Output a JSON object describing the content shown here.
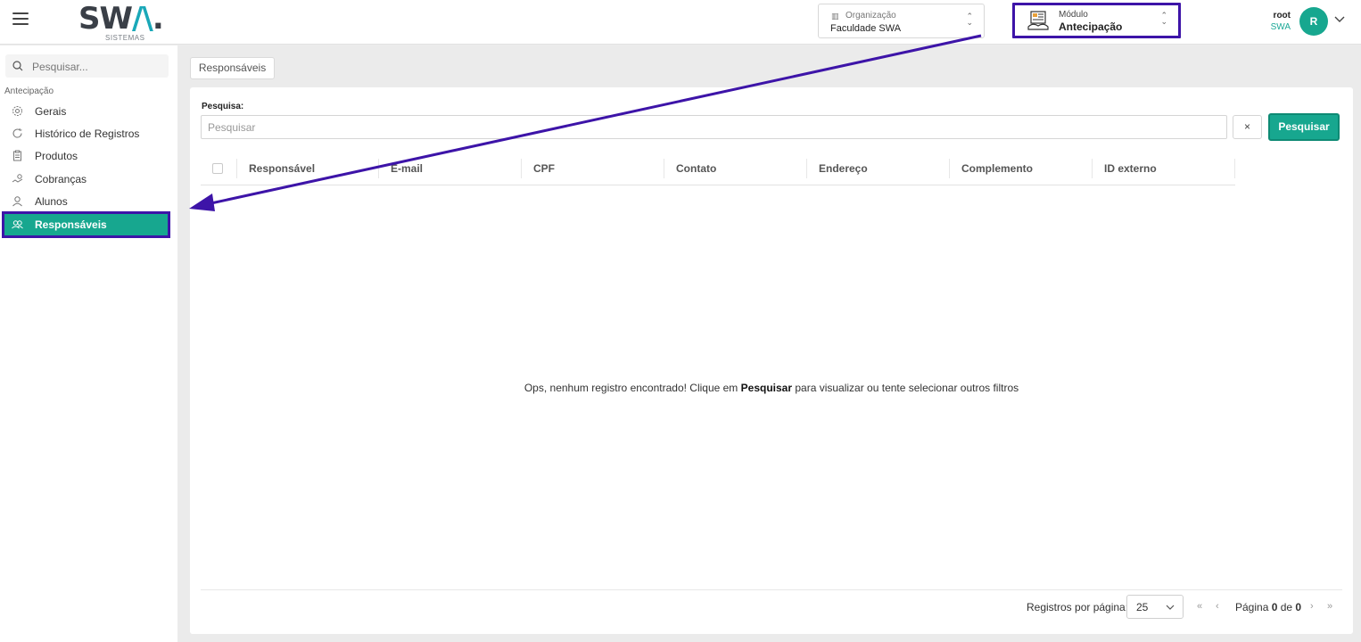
{
  "header": {
    "logo_main": "SW",
    "logo_accent": "/\\",
    "logo_dot": ".",
    "logo_sub": "SISTEMAS",
    "org_label": "Organização",
    "org_value": "Faculdade SWA",
    "module_label": "Módulo",
    "module_value": "Antecipação",
    "user_name": "root",
    "user_org": "SWA",
    "avatar_initial": "R"
  },
  "sidebar": {
    "search_placeholder": "Pesquisar...",
    "section": "Antecipação",
    "items": [
      {
        "label": "Gerais",
        "icon": "gear-icon"
      },
      {
        "label": "Histórico de Registros",
        "icon": "history-icon"
      },
      {
        "label": "Produtos",
        "icon": "clipboard-icon"
      },
      {
        "label": "Cobranças",
        "icon": "money-icon"
      },
      {
        "label": "Alunos",
        "icon": "user-icon"
      },
      {
        "label": "Responsáveis",
        "icon": "users-icon",
        "active": true
      }
    ]
  },
  "main": {
    "tab": "Responsáveis",
    "search_label": "Pesquisa:",
    "search_placeholder": "Pesquisar",
    "clear_label": "×",
    "search_button": "Pesquisar",
    "columns": [
      "Responsável",
      "E-mail",
      "CPF",
      "Contato",
      "Endereço",
      "Complemento",
      "ID externo"
    ],
    "empty_prefix": "Ops, nenhum registro encontrado! Clique em ",
    "empty_bold": "Pesquisar",
    "empty_suffix": " para visualizar ou tente selecionar outros filtros",
    "per_page_label": "Registros por página:",
    "per_page_value": "25",
    "page_prefix": "Página ",
    "page_current": "0",
    "page_mid": " de ",
    "page_total": "0"
  },
  "colors": {
    "accent": "#17a78f",
    "annotation": "#3d14a8"
  }
}
